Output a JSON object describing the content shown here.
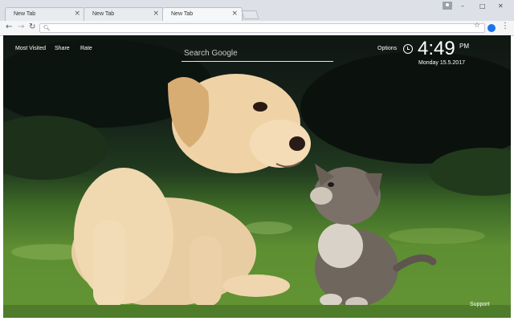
{
  "browser": {
    "tabs": [
      {
        "title": "New Tab",
        "active": false
      },
      {
        "title": "New Tab",
        "active": false
      },
      {
        "title": "New Tab",
        "active": true
      }
    ],
    "tab_close_glyph": "×",
    "window_controls": {
      "minimize": "–",
      "maximize": "□",
      "close": "✕"
    },
    "nav_icons": {
      "back": "←",
      "forward": "→",
      "reload": "↻"
    },
    "address_value": "",
    "star_icon": "☆",
    "menu_icon": "⋮"
  },
  "page": {
    "links": {
      "most_visited": "Most Visited",
      "share": "Share",
      "rate": "Rate"
    },
    "search": {
      "placeholder": "Search Google"
    },
    "options": "Options",
    "clock": {
      "time": "4:49",
      "ampm": "PM",
      "date": "Monday  15.5.2017"
    },
    "support": "Support"
  },
  "background_image": {
    "subject_icon": "puppy-and-kitten-photo",
    "colors": {
      "sky": "#101713",
      "grass": "#5e8d33",
      "puppy": "#e6c79c",
      "kitten": "#6d6257"
    }
  }
}
